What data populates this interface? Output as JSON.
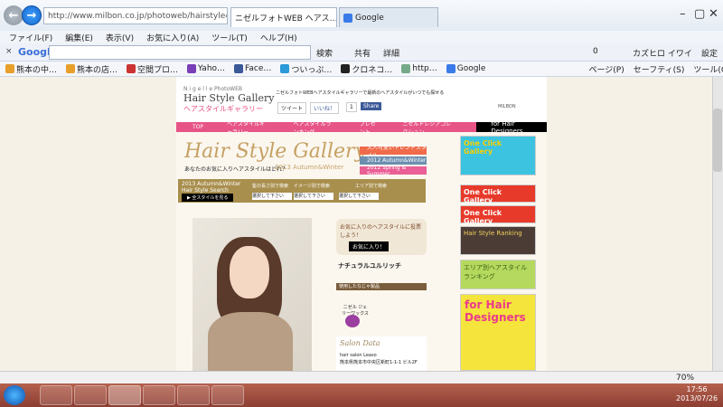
{
  "browser": {
    "address": "http://www.milbon.co.jp/photoweb/hairstyle4/20",
    "tabs": [
      "ニゼルフォトWEB ヘアス…",
      "Google"
    ],
    "menu": [
      "ファイル(F)",
      "編集(E)",
      "表示(V)",
      "お気に入り(A)",
      "ツール(T)",
      "ヘルプ(H)"
    ],
    "google_label": "Google",
    "search_btn": "検索",
    "share": "共有",
    "detail": "詳細",
    "counter": "0",
    "user": "カズヒロ イワイ",
    "settings": "設定"
  },
  "favorites": [
    "熊本の中…",
    "熊本の店…",
    "空間プロ…",
    "Yaho…",
    "Face…",
    "ついっぷ…",
    "クロネコ…",
    "http…",
    "Google"
  ],
  "ie_tools": [
    "ページ(P)",
    "セーフティ(S)",
    "ツール(O)"
  ],
  "site": {
    "brand_small": "N i g e l l e PhotoWEB",
    "brand_title": "Hair Style Gallery",
    "brand_sub": "ヘアスタイルギャラリー",
    "tagline": "ニゼルフォトWEBヘアスタイルギャラリーで最新のヘアスタイルがいつでも探せる",
    "tweet": "ツイート",
    "like": "いいね！",
    "like_count": "1",
    "share": "Share",
    "company": "MILBON",
    "nav": [
      "TOP",
      "ヘアスタイルギャラリー",
      "ヘアスタイルランキング",
      "プレゼント",
      "ニゼルドレシアコレクション",
      "for Hair Designers"
    ],
    "hsg": "Hair Style Gallery",
    "hsg_q": "あなたのお気に入りヘアスタイルはどれ？",
    "hsg_season": "2013 Autumn&Winter",
    "seasons": [
      "大人可愛いトレンドスタイル",
      "2012 Autumn&Winter",
      "2012 Spring & Summer"
    ],
    "search": {
      "season_title": "2013 Autumn&Winter",
      "season_sub": "Hair Style Search",
      "look_btn": "▶ 全スタイルを見る",
      "len": "髪の長さ別で検索",
      "img": "イメージ別で検索",
      "area": "エリア別で検索",
      "opt": "選択して下さい"
    },
    "fav_q": "お気に入りのヘアスタイルに投票しよう！",
    "fav_btn": "お気に入り！",
    "style_name": "ナチュラルユルリッチ",
    "used": "使用したなじゃ製品",
    "product": "ニゼル ジェリーワックス",
    "salon": "Salon Data",
    "salon_name": "hair salon Leaso",
    "salon_addr": "熊本県熊本市中央区新町1-1-1 ビル2F",
    "banners": [
      "One Click Gallery",
      "One Click Gallery",
      "One Click Gallery",
      "Hair Style Ranking",
      "エリア別ヘアスタイルランキング",
      "for Hair Designers"
    ]
  },
  "status": {
    "zoom": "70%"
  },
  "clock": {
    "time": "17:56",
    "date": "2013/07/26"
  }
}
